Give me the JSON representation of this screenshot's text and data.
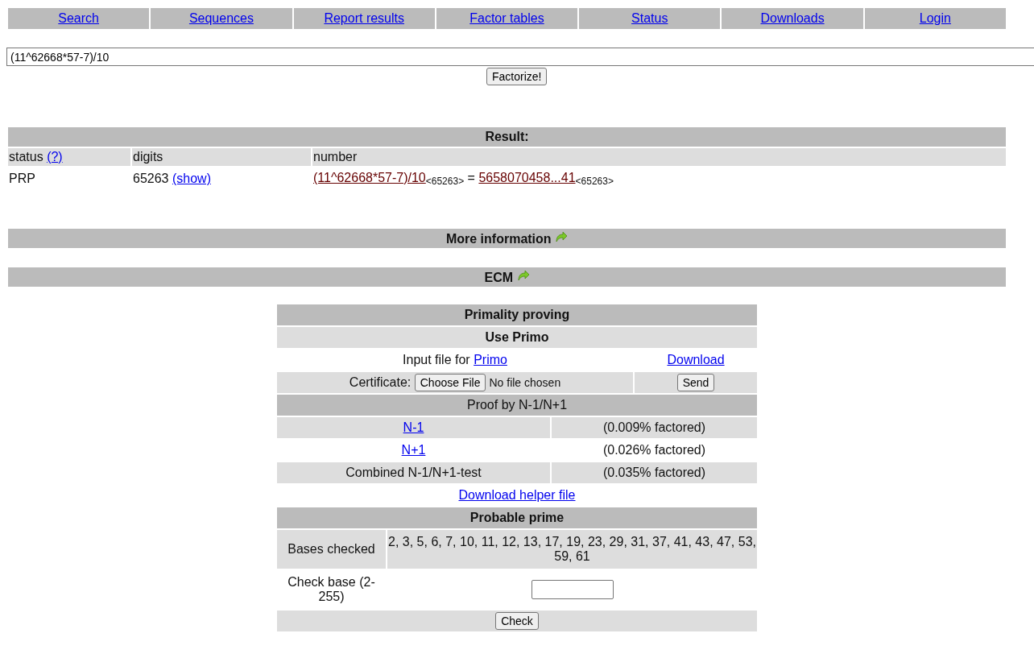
{
  "nav": [
    {
      "label": "Search"
    },
    {
      "label": "Sequences"
    },
    {
      "label": "Report results"
    },
    {
      "label": "Factor tables"
    },
    {
      "label": "Status"
    },
    {
      "label": "Downloads"
    },
    {
      "label": "Login"
    }
  ],
  "query": {
    "value": "(11^62668*57-7)/10"
  },
  "factorize_button": "Factorize!",
  "result": {
    "title": "Result:",
    "columns": [
      {
        "label": "status",
        "help": "(?)"
      },
      {
        "label": "digits"
      },
      {
        "label": "number"
      }
    ],
    "row": {
      "status": "PRP",
      "digits": "65263",
      "show": "(show)",
      "expression": "(11^62668*57-7)/10",
      "expression_digits": "<65263>",
      "equals": "=",
      "value": "5658070458...41",
      "value_digits": "<65263>"
    }
  },
  "sections": [
    {
      "title": "More information"
    },
    {
      "title": "ECM"
    }
  ],
  "primality": {
    "title": "Primality proving",
    "primo": {
      "title": "Use Primo",
      "input_label": "Input file for",
      "primo_link": "Primo",
      "download_link": "Download",
      "certificate_label": "Certificate:",
      "choose_file": "Choose File",
      "no_file": "No file chosen",
      "send": "Send"
    },
    "proof": {
      "title": "Proof by N-1/N+1",
      "rows": [
        {
          "kind": "link",
          "label": "N-1",
          "result": "(0.009% factored)"
        },
        {
          "kind": "link",
          "label": "N+1",
          "result": "(0.026% factored)"
        },
        {
          "kind": "text",
          "label": "Combined N-1/N+1-test",
          "result": "(0.035% factored)"
        }
      ],
      "helper_link": "Download helper file"
    },
    "probable": {
      "title": "Probable prime",
      "bases_label": "Bases checked",
      "bases": "2, 3, 5, 6, 7, 10, 11, 12, 13, 17, 19, 23, 29, 31, 37, 41, 43, 47, 53, 59, 61",
      "check_label": "Check base (2-255)",
      "check_button": "Check"
    }
  }
}
